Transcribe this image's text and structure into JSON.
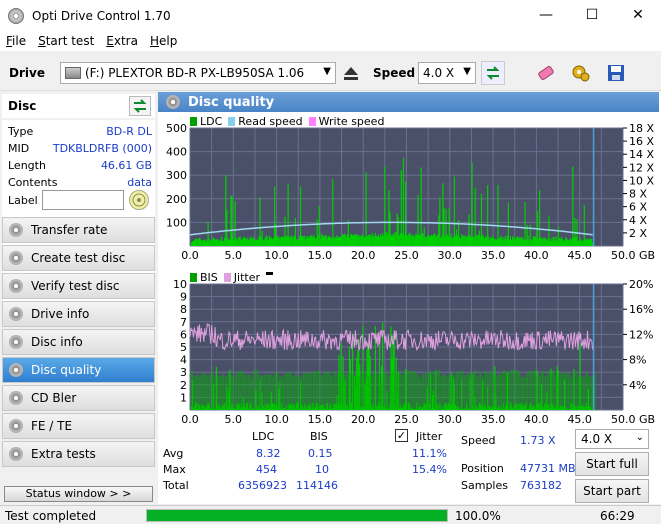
{
  "window": {
    "title": "Opti Drive Control 1.70",
    "minimize": "—",
    "maximize": "☐",
    "close": "✕"
  },
  "menu": [
    {
      "label": "File",
      "u": "F",
      "rest": "ile"
    },
    {
      "label": "Start test",
      "u": "S",
      "rest": "tart test"
    },
    {
      "label": "Extra",
      "u": "E",
      "rest": "xtra"
    },
    {
      "label": "Help",
      "u": "H",
      "rest": "elp"
    }
  ],
  "toolbar": {
    "drive_label": "Drive",
    "drive_value": "(F:)  PLEXTOR BD-R  PX-LB950SA 1.06",
    "speed_label": "Speed",
    "speed_value": "4.0 X"
  },
  "disc": {
    "header": "Disc",
    "rows": [
      {
        "key": "Type",
        "value": "BD-R DL"
      },
      {
        "key": "MID",
        "value": "TDKBLDRFB (000)"
      },
      {
        "key": "Length",
        "value": "46.61 GB"
      },
      {
        "key": "Contents",
        "value": "data"
      }
    ],
    "label_key": "Label",
    "label_value": ""
  },
  "nav": [
    {
      "label": "Transfer rate",
      "active": false
    },
    {
      "label": "Create test disc",
      "active": false
    },
    {
      "label": "Verify test disc",
      "active": false
    },
    {
      "label": "Drive info",
      "active": false
    },
    {
      "label": "Disc info",
      "active": false
    },
    {
      "label": "Disc quality",
      "active": true
    },
    {
      "label": "CD Bler",
      "active": false
    },
    {
      "label": "FE / TE",
      "active": false
    },
    {
      "label": "Extra tests",
      "active": false
    }
  ],
  "status_window_label": "Status window > >",
  "panel": {
    "title": "Disc quality",
    "legend_top": [
      {
        "label": "LDC",
        "color": "#00a000"
      },
      {
        "label": "Read speed",
        "color": "#87ceeb"
      },
      {
        "label": "Write speed",
        "color": "#ff80ff"
      }
    ],
    "legend_bottom": [
      {
        "label": "BIS",
        "color": "#00a000"
      },
      {
        "label": "Jitter",
        "color": "#e0a0e0"
      }
    ]
  },
  "chart_data": [
    {
      "type": "bar",
      "title": "LDC / Read speed",
      "xlabel": "GB",
      "x_ticks": [
        "0.0",
        "5.0",
        "10.0",
        "15.0",
        "20.0",
        "25.0",
        "30.0",
        "35.0",
        "40.0",
        "45.0",
        "50.0 GB"
      ],
      "y_ticks_left": [
        "500",
        "400",
        "300",
        "200",
        "100"
      ],
      "y_ticks_right": [
        "18 X",
        "16 X",
        "14 X",
        "12 X",
        "10 X",
        "8 X",
        "6 X",
        "4 X",
        "2 X"
      ],
      "xlim": [
        0,
        50
      ],
      "ylim": [
        0,
        500
      ],
      "y2lim": [
        0,
        18
      ],
      "series": [
        {
          "name": "LDC",
          "color": "#00c000",
          "baseline": 30,
          "peak_max": 454
        },
        {
          "name": "Read speed",
          "color": "#87ceeb",
          "values_x": [
            0,
            12.5,
            23.3,
            35,
            46.6
          ],
          "values_y": [
            1.7,
            3.0,
            3.6,
            3.0,
            1.7
          ]
        }
      ]
    },
    {
      "type": "bar",
      "title": "BIS / Jitter",
      "xlabel": "GB",
      "x_ticks": [
        "0.0",
        "5.0",
        "10.0",
        "15.0",
        "20.0",
        "25.0",
        "30.0",
        "35.0",
        "40.0",
        "45.0",
        "50.0 GB"
      ],
      "y_ticks_left": [
        "10",
        "9",
        "8",
        "7",
        "6",
        "5",
        "4",
        "3",
        "2",
        "1"
      ],
      "y_ticks_right": [
        "20%",
        "16%",
        "12%",
        "8%",
        "4%"
      ],
      "xlim": [
        0,
        50
      ],
      "ylim": [
        0,
        10
      ],
      "y2lim": [
        0,
        20
      ],
      "series": [
        {
          "name": "BIS",
          "color": "#00c000",
          "peak_max": 10
        },
        {
          "name": "Jitter",
          "color": "#e0a0e0",
          "avg": 11.1,
          "max": 15.4
        }
      ]
    }
  ],
  "stats": {
    "col_ldc": "LDC",
    "col_bis": "BIS",
    "jitter_label": "Jitter",
    "jitter_checked": true,
    "rows": [
      {
        "label": "Avg",
        "ldc": "8.32",
        "bis": "0.15",
        "jitter": "11.1%"
      },
      {
        "label": "Max",
        "ldc": "454",
        "bis": "10",
        "jitter": "15.4%"
      },
      {
        "label": "Total",
        "ldc": "6356923",
        "bis": "114146",
        "jitter": ""
      }
    ],
    "speed_label": "Speed",
    "speed_value": "1.73 X",
    "position_label": "Position",
    "position_value": "47731 MB",
    "samples_label": "Samples",
    "samples_value": "763182",
    "speed_select": "4.0 X",
    "start_full": "Start full",
    "start_part": "Start part"
  },
  "status": {
    "text": "Test completed",
    "progress_percent": 100.0,
    "progress_label": "100.0%",
    "time": "66:29"
  }
}
